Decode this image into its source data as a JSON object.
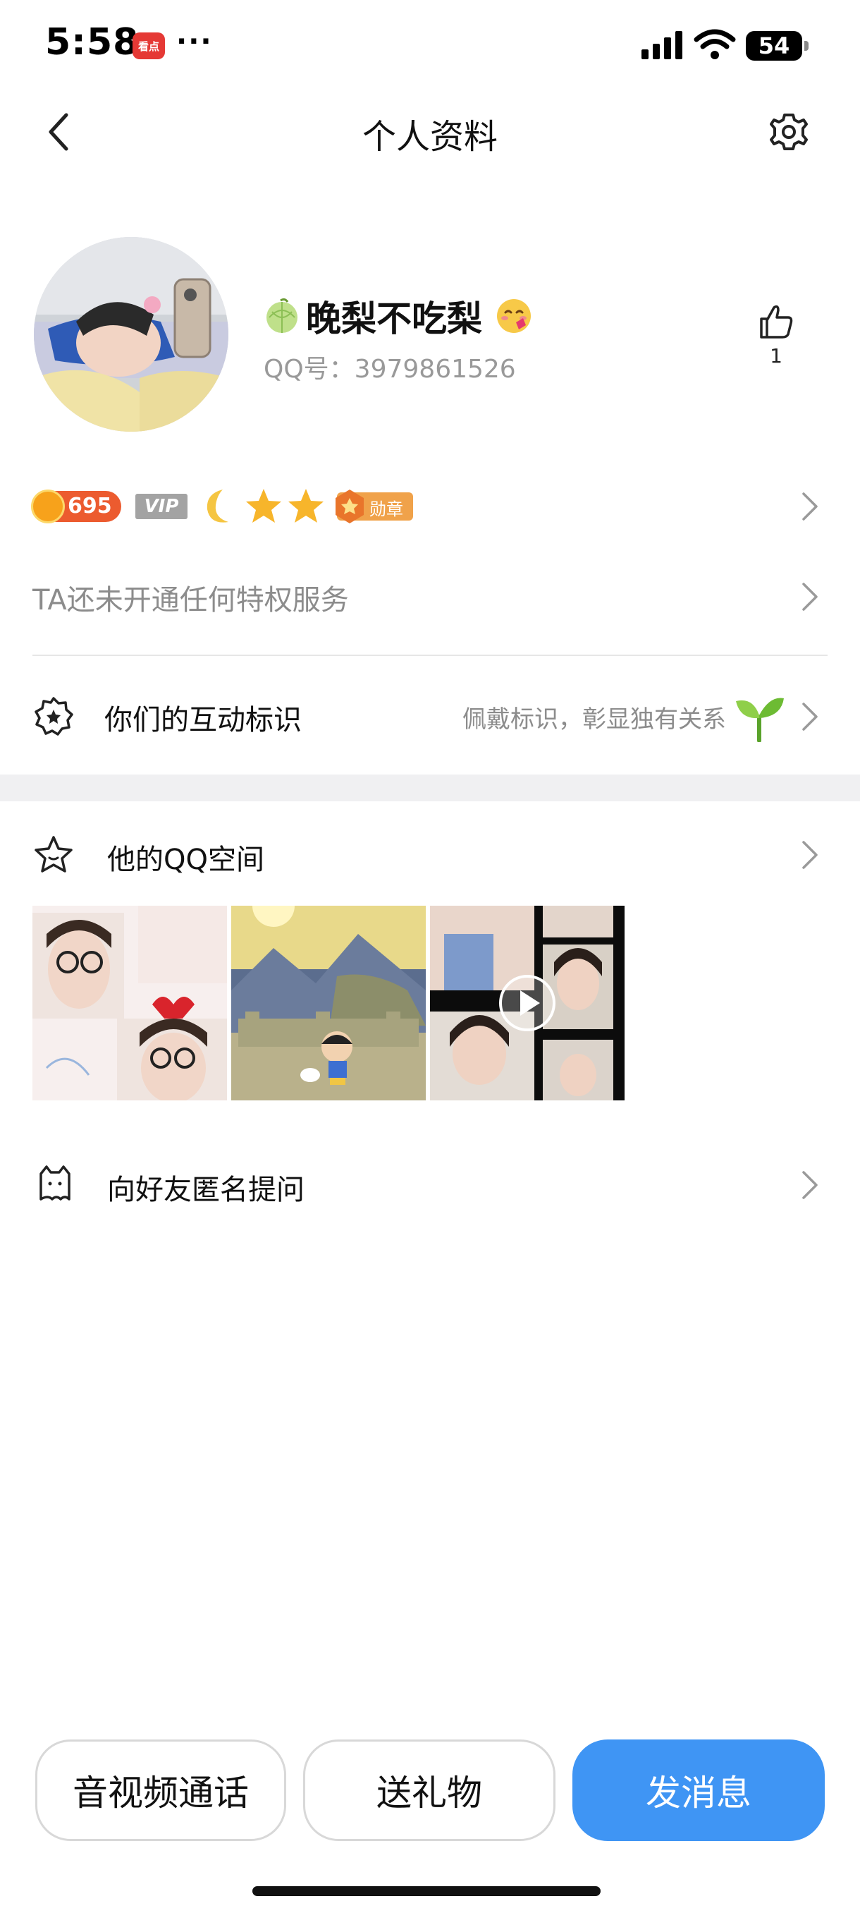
{
  "status_bar": {
    "time": "5:58",
    "app_badge": "看点",
    "more": "···",
    "battery": "54"
  },
  "nav": {
    "title": "个人资料"
  },
  "profile": {
    "nickname": "晚梨不吃梨",
    "qq_number": "QQ号：3979861526",
    "like_count": "1"
  },
  "badges": {
    "coin_value": "695",
    "vip_label": "VIP",
    "medal_label": "勋章"
  },
  "privilege": {
    "text": "TA还未开通任何特权服务"
  },
  "interaction": {
    "label": "你们的互动标识",
    "hint": "佩戴标识，彰显独有关系"
  },
  "qzone": {
    "label": "他的QQ空间"
  },
  "ask": {
    "label": "向好友匿名提问"
  },
  "actions": {
    "call": "音视频通话",
    "gift": "送礼物",
    "message": "发消息"
  },
  "colors": {
    "primary": "#3f95f4",
    "coin": "#ec5b2f",
    "vip": "#a3a3a3",
    "section_gap": "#f0f0f2"
  },
  "icons": {
    "back": "chevron-left-icon",
    "settings": "gear-icon",
    "like": "thumbs-up-icon",
    "interaction": "badge-gear-icon",
    "qzone": "star-outline-icon",
    "ask": "ghost-cat-icon",
    "row_arrow": "chevron-right-icon"
  }
}
